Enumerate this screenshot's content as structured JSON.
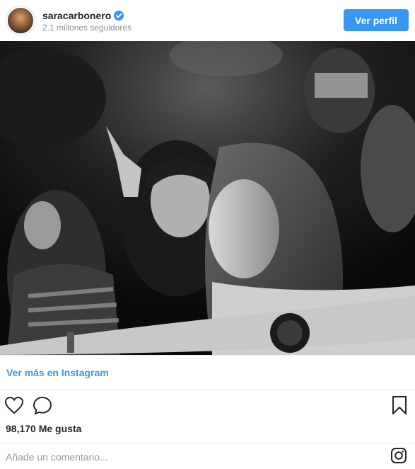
{
  "header": {
    "username": "saracarbonero",
    "verified_icon": "verified-badge-icon",
    "followers": "2.1 millones seguidores",
    "view_profile_label": "Ver perfil"
  },
  "post": {
    "image_icon": "photo",
    "more_link": "Ver más en Instagram",
    "likes": "98,170 Me gusta",
    "comment_placeholder": "Añade un comentario..."
  },
  "icons": {
    "like": "heart-icon",
    "comment": "comment-bubble-icon",
    "save": "bookmark-icon",
    "instagram": "instagram-logo-icon"
  },
  "colors": {
    "accent": "#3897f0",
    "text": "#262626",
    "muted": "#8e8e8e",
    "divider": "#efefef"
  }
}
